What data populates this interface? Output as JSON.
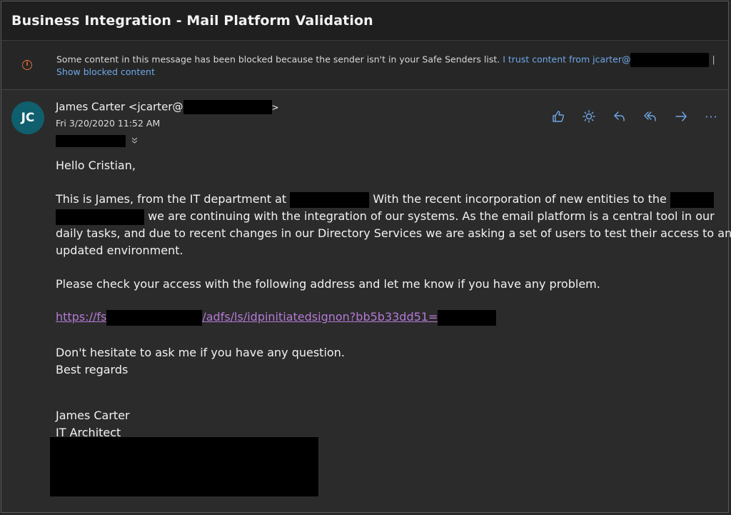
{
  "email": {
    "subject": "Business Integration - Mail Platform Validation",
    "warning": {
      "text": "Some content in this message has been blocked because the sender isn't in your Safe Senders list.",
      "trust_link": "I trust content from jcarter@",
      "separator": "|",
      "show_blocked": "Show blocked content"
    },
    "sender": {
      "initials": "JC",
      "name_prefix": "James Carter <jcarter@",
      "name_suffix": ">",
      "date": "Fri 3/20/2020 11:52 AM"
    },
    "actions": [
      "like-icon",
      "sun-icon",
      "reply-icon",
      "reply-all-icon",
      "forward-icon",
      "more-icon"
    ],
    "more_label": "···",
    "body": {
      "greeting": "Hello Cristian,",
      "p1_line1_a": "This is James, from the IT department at",
      "p1_line1_b": "With the recent incorporation of new entities to the",
      "p1_line2": "we are continuing with the integration of our systems. As the email platform is a central tool in our",
      "p1_line3": "daily tasks, and due to recent changes in our Directory Services we are asking a set of users to test their access to an",
      "p1_line4": "updated environment.",
      "p2": "Please check your access with the following address and let me know if you have any problem.",
      "url_a": "https://fs",
      "url_b": "/adfs/ls/idpinitiatedsignon?bb5b33dd51=",
      "p3_line1": "Don't hesitate to ask me if you have any question.",
      "p3_line2": "Best regards",
      "sig_name": "James Carter",
      "sig_title": "IT Architect"
    }
  },
  "colors": {
    "background": "#2b2b2b",
    "link_blue": "#6fa8e8",
    "visited_link": "#b57ad6",
    "avatar": "#0f5f6e",
    "warning_icon": "#e0703a"
  }
}
